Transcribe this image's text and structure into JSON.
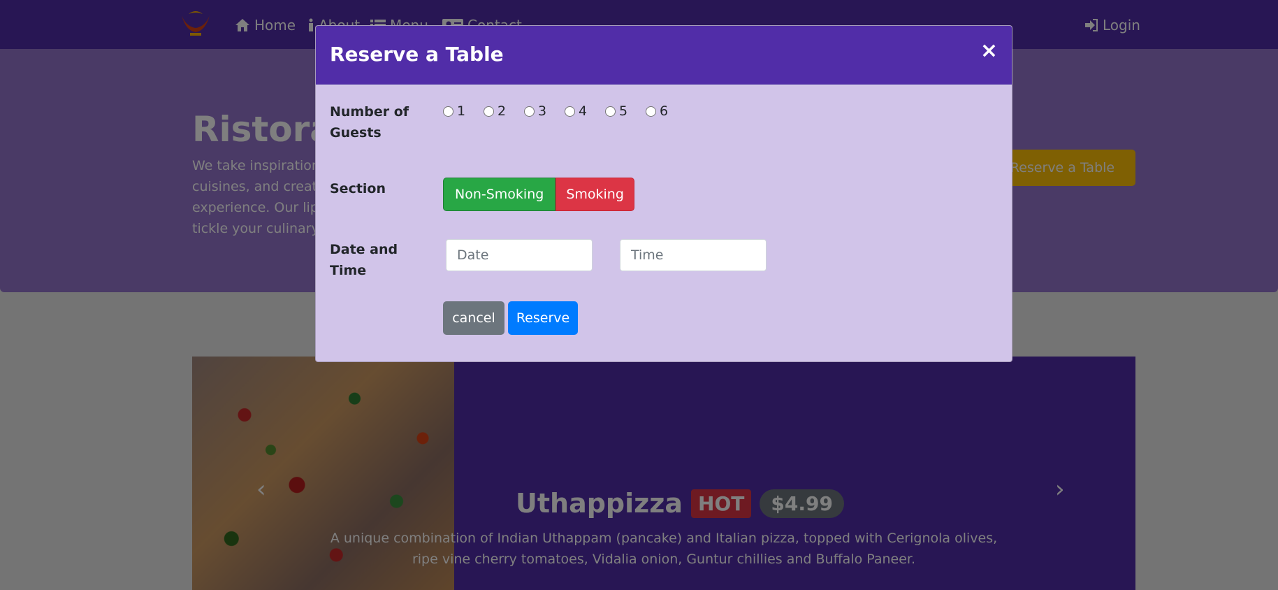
{
  "navbar": {
    "items": [
      {
        "label": "Home",
        "icon": "home-icon"
      },
      {
        "label": "About",
        "icon": "info-icon"
      },
      {
        "label": "Menu",
        "icon": "list-icon"
      },
      {
        "label": "Contact",
        "icon": "address-card-icon"
      }
    ],
    "login_label": "Login",
    "login_icon": "sign-in-icon"
  },
  "jumbotron": {
    "title": "Ristorante con Fusion",
    "text": "We take inspiration from the World's best cuisines, and create a unique fusion experience. Our lipsmacking creations will tickle your culinary senses!",
    "button_label": "Reserve a Table"
  },
  "carousel": {
    "dish_name": "Uthappizza",
    "badge": "HOT",
    "price": "$4.99",
    "description": "A unique combination of Indian Uthappam (pancake) and Italian pizza, topped with Cerignola olives, ripe vine cherry tomatoes, Vidalia onion, Guntur chillies and Buffalo Paneer."
  },
  "modal": {
    "title": "Reserve a Table",
    "close_symbol": "×",
    "guests_label": "Number of Guests",
    "guests_options": [
      "1",
      "2",
      "3",
      "4",
      "5",
      "6"
    ],
    "section_label": "Section",
    "section_options": [
      "Non-Smoking",
      "Smoking"
    ],
    "datetime_label": "Date and Time",
    "date_placeholder": "Date",
    "time_placeholder": "Time",
    "cancel_label": "cancel",
    "reserve_label": "Reserve"
  },
  "colors": {
    "primary": "#512da8",
    "light": "#d1c4e9",
    "jumbotron": "#9575cd",
    "success": "#28a745",
    "danger": "#dc3545",
    "secondary": "#6c757d",
    "blue": "#007bff",
    "warning": "#ffc107"
  }
}
